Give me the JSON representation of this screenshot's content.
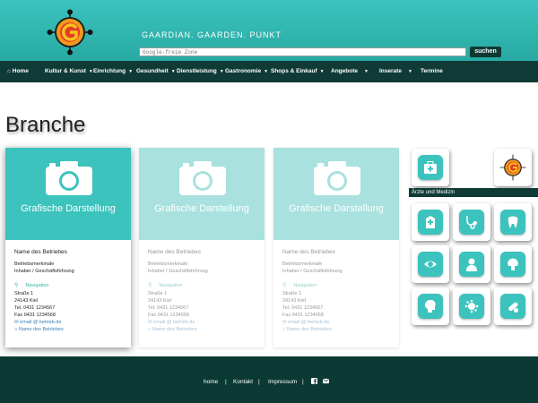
{
  "header": {
    "tagline": "GAARDIAN. GAARDEN. PUNKT",
    "search_placeholder": "Google-freie Zone",
    "search_label": "suchen"
  },
  "nav": {
    "items": [
      {
        "label": "Home",
        "icon": "home-icon"
      },
      {
        "label": "Kultur & Kunst",
        "dropdown": true
      },
      {
        "label": "Einrichtung",
        "dropdown": true
      },
      {
        "label": "Gesundheit",
        "dropdown": true
      },
      {
        "label": "Dienstleistung",
        "dropdown": true
      },
      {
        "label": "Gastronomie",
        "dropdown": true
      },
      {
        "label": "Shops & Einkauf",
        "dropdown": true
      },
      {
        "label": "Angebote",
        "dropdown": true
      },
      {
        "label": "Inserate",
        "dropdown": true
      },
      {
        "label": "Termine",
        "dropdown": false
      }
    ]
  },
  "page": {
    "title": "Branche"
  },
  "cards": [
    {
      "banner": "Grafische Darstellung",
      "name": "Name des Betriebes",
      "sub1": "Betriebsmerkmale",
      "sub2": "Inhaber / Geschäftsführung",
      "navigation": "Navigation",
      "street": "Straße   1",
      "city": "24143 Kiel",
      "tel": "Tel. 0431 1234567",
      "fax": "Fax 0431 1234568",
      "email": "email @ betrieb.de",
      "link": "Name des Betriebes"
    },
    {
      "banner": "Grafische Darstellung",
      "name": "Name des Betriebes",
      "sub1": "Betriebsmerkmale",
      "sub2": "Inhaber / Geschäftsführung",
      "navigation": "Navigation",
      "street": "Straße   1",
      "city": "24143 Kiel",
      "tel": "Tel. 0431 1234567",
      "fax": "Fax 0431 1234568",
      "email": "email @ betrieb.de",
      "link": "Name des Betriebes"
    },
    {
      "banner": "Grafische Darstellung",
      "name": "Name des Betriebes",
      "sub1": "Betriebsmerkmale",
      "sub2": "Inhaber / Geschäftsführung",
      "navigation": "Navigation",
      "street": "Straße   1",
      "city": "24143 Kiel",
      "tel": "Tel. 0431 1234567",
      "fax": "Fax 0431 1234568",
      "email": "email @ betrieb.de",
      "link": "Name des Betriebes"
    }
  ],
  "category": {
    "label": "Ärzte und Medizin",
    "icons": [
      "hospital-icon",
      "stethoscope-icon",
      "tooth-icon",
      "eye-icon",
      "doctor-icon",
      "brain-icon",
      "head-icon",
      "virus-icon",
      "pills-icon"
    ]
  },
  "footer": {
    "links": [
      "home",
      "Kontakt",
      "Impressum"
    ],
    "separator": "|",
    "icons": [
      "facebook-icon",
      "mail-icon"
    ]
  },
  "colors": {
    "teal": "#3cc3bd",
    "dark": "#0f3a36",
    "faded_teal": "#a8e1de",
    "link": "#3f7fb7"
  }
}
